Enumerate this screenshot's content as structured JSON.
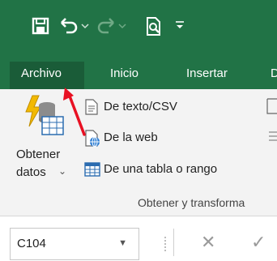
{
  "ribbon_tabs": [
    {
      "label": "Archivo",
      "active": true
    },
    {
      "label": "Inicio"
    },
    {
      "label": "Insertar"
    },
    {
      "label": "D"
    }
  ],
  "qat": {
    "icons": [
      "save-icon",
      "undo-icon",
      "undo-dropdown-icon",
      "redo-icon",
      "redo-dropdown-icon",
      "print-preview-icon",
      "customize-qat-icon"
    ]
  },
  "get_data": {
    "label_line1": "Obtener",
    "label_line2": "datos",
    "caret": "⌄"
  },
  "commands": [
    {
      "label": "De texto/CSV",
      "icon": "text-csv-icon"
    },
    {
      "label": "De la web",
      "icon": "web-icon"
    },
    {
      "label": "De una tabla o rango",
      "icon": "table-range-icon"
    }
  ],
  "group_label": "Obtener y transforma",
  "formula_bar": {
    "name_box_value": "C104",
    "cancel_glyph": "✕",
    "enter_glyph": "✓"
  },
  "colors": {
    "title_bar": "#217346",
    "active_tab": "#1a5c38",
    "annotation_arrow": "#e81123"
  }
}
